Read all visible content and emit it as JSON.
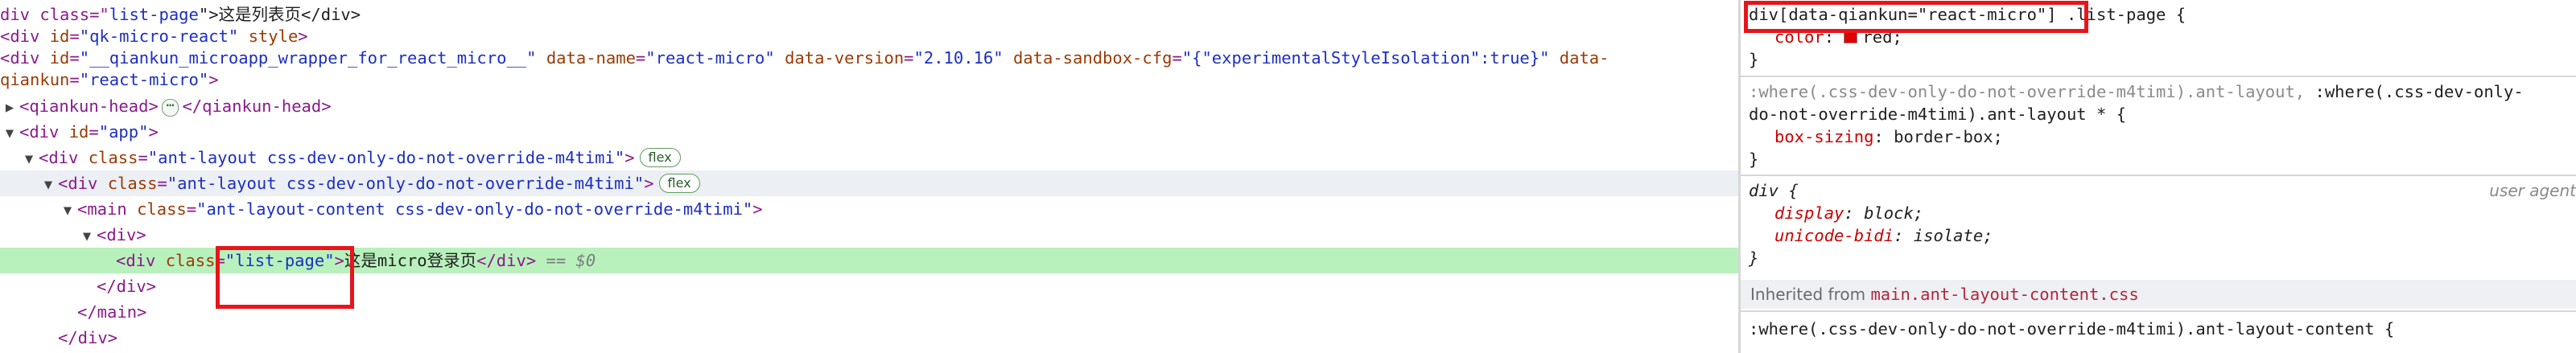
{
  "elements": {
    "lines": [
      {
        "text_open": "iv class=\"",
        "attr_value": "list-page",
        "text_close": "\">这是列表页</div>"
      },
      {
        "text": "<div id=\"qk-micro-react\" style>"
      },
      {
        "prefix": "<div id=\"",
        "id_value": "__qiankun_microapp_wrapper_for_react_micro__",
        "name_attr": "data-name",
        "name_value": "react-micro",
        "version_attr": "data-version",
        "version_value": "2.10.16",
        "sandbox_attr": "data-sandbox-cfg",
        "sandbox_value": "{\"experimentalStyleIsolation\":true}",
        "qk_attr": "data-"
      },
      {
        "text": "qiankun=\"react-micro\">"
      },
      {
        "open_tag": "<qiankun-head>",
        "ellipsis": "⋯",
        "close_tag": "</qiankun-head>"
      },
      {
        "tag": "div",
        "attr": "id",
        "value": "app"
      },
      {
        "tag": "div",
        "attr": "class",
        "value": "ant-layout css-dev-only-do-not-override-m4timi",
        "badge": "flex"
      },
      {
        "tag": "div",
        "attr": "class",
        "value": "ant-layout css-dev-only-do-not-override-m4timi",
        "badge": "flex"
      },
      {
        "tag": "main",
        "attr": "class",
        "value": "ant-layout-content css-dev-only-do-not-override-m4timi"
      },
      {
        "text": "<div>"
      },
      {
        "tag": "div",
        "attr": "class",
        "value": "list-page",
        "content": "这是micro登录页",
        "close": "</div>",
        "selected_marker": "== $0"
      },
      {
        "text": "</div>"
      },
      {
        "text": "</main>"
      },
      {
        "text": "</div>"
      }
    ]
  },
  "styles": {
    "rule1": {
      "selector_boxed": "div[data-qiankun=\"react-micro\"]",
      "selector_rest": " .list-page {",
      "prop": "color",
      "value": "red;",
      "swatch_color": "#e00000",
      "close": "}"
    },
    "rule2": {
      "selector_line1_dim": ":where(.css-dev-only-do-not-override-m4timi).ant-layout,",
      "selector_line1_em": " :where(.css-dev-only-",
      "selector_line2_em": "do-not-override-m4timi).ant-layout * {",
      "prop": "box-sizing",
      "value": "border-box;",
      "close": "}"
    },
    "rule3": {
      "selector": "div {",
      "origin": "user agent",
      "props": [
        {
          "name": "display",
          "value": "block;"
        },
        {
          "name": "unicode-bidi",
          "value": "isolate;"
        }
      ],
      "close": "}"
    },
    "inherited": {
      "label": "Inherited from ",
      "link": "main.ant-layout-content.css"
    },
    "rule4": {
      "selector": ":where(.css-dev-only-do-not-override-m4timi).ant-layout-content {"
    }
  }
}
